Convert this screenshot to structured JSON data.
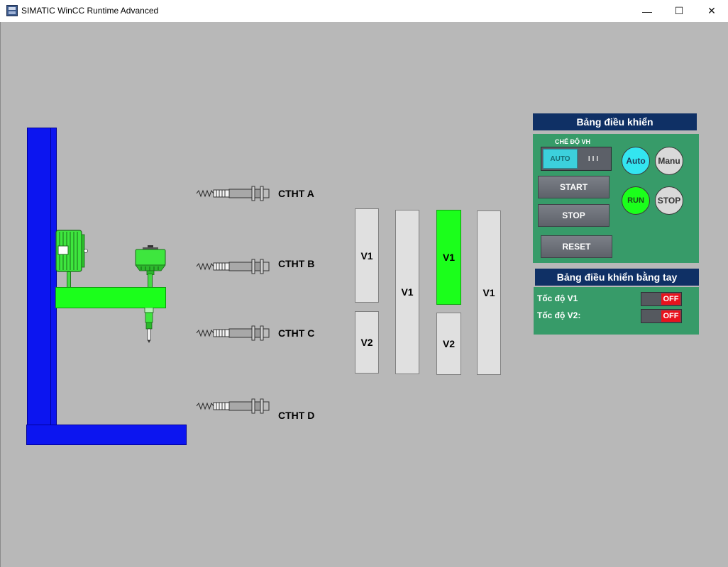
{
  "window": {
    "title": "SIMATIC WinCC Runtime Advanced",
    "controls": {
      "minimize": "—",
      "maximize": "☐",
      "close": "✕"
    }
  },
  "sensors": [
    {
      "label": "CTHT A"
    },
    {
      "label": "CTHT B"
    },
    {
      "label": "CTHT C"
    },
    {
      "label": "CTHT D"
    }
  ],
  "pallets": [
    {
      "label": "V1",
      "active": false
    },
    {
      "label": "V2",
      "active": false
    },
    {
      "label": "V1",
      "active": false
    },
    {
      "label": "V1",
      "active": true
    },
    {
      "label": "V2",
      "active": false
    },
    {
      "label": "V1",
      "active": false
    }
  ],
  "control_panel": {
    "title": "Bảng điều khiển",
    "mode_caption": "CHẾ ĐỘ VH",
    "mode_auto": "AUTO",
    "mode_manual": "III",
    "start": "START",
    "stop": "STOP",
    "reset": "RESET",
    "lamps": {
      "auto": "Auto",
      "manu": "Manu",
      "run": "RUN",
      "stop": "STOP"
    }
  },
  "manual_panel": {
    "title": "Bảng điều khiển bằng tay",
    "rows": [
      {
        "label": "Tốc độ V1",
        "state": "OFF"
      },
      {
        "label": "Tốc độ V2:",
        "state": "OFF"
      }
    ]
  },
  "colors": {
    "frame": "#0c15f0",
    "machine_green": "#1bff1b",
    "panel_green": "#379b69",
    "panel_header": "#0f3065",
    "lamp_auto": "#33e5f0",
    "lamp_run": "#1bff1b",
    "lamp_off": "#d9d9d9",
    "off_red": "#e9121d"
  }
}
